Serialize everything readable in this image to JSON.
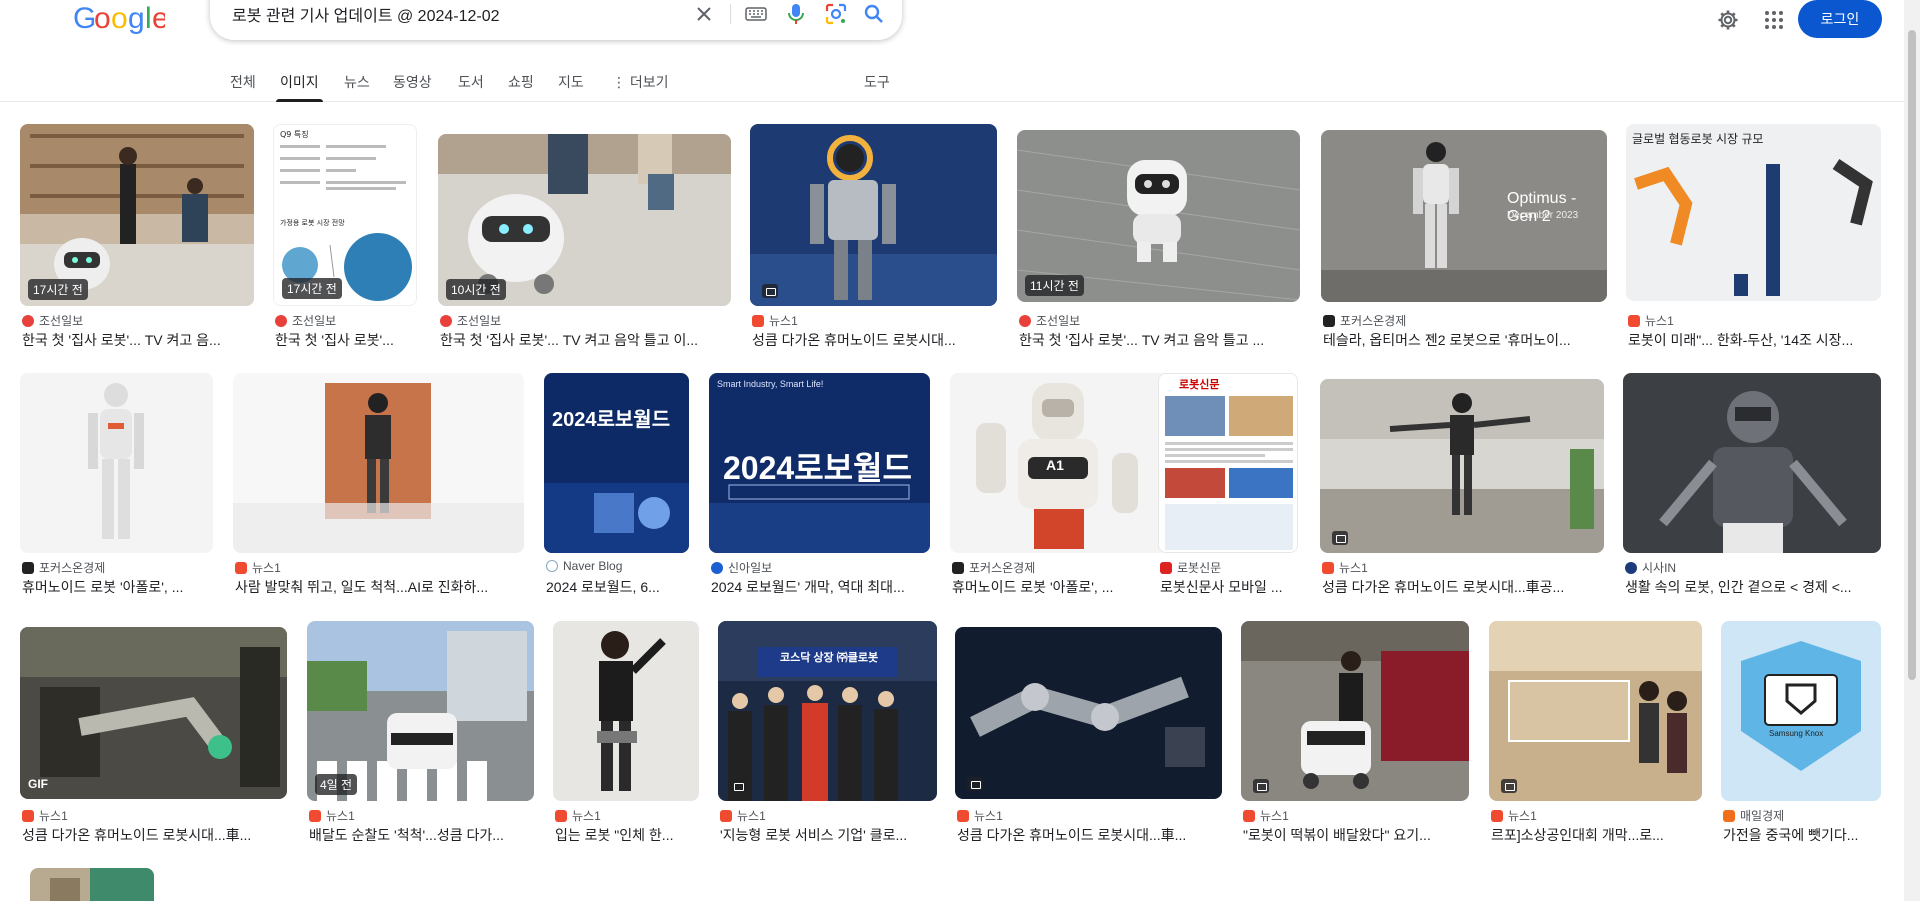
{
  "logo": {
    "text": "Google"
  },
  "search": {
    "query": "로봇 관련 기사 업데이트 @ 2024-12-02",
    "placeholder": ""
  },
  "header": {
    "login_label": "로그인"
  },
  "tabs": [
    {
      "label": "전체"
    },
    {
      "label": "이미지"
    },
    {
      "label": "뉴스"
    },
    {
      "label": "동영상"
    },
    {
      "label": "도서"
    },
    {
      "label": "쇼핑"
    },
    {
      "label": "지도"
    },
    {
      "label": "⋮ 더보기"
    },
    {
      "label": "도구"
    }
  ],
  "results": [
    {
      "source": "조선일보",
      "title": "한국 첫 '집사 로봇'... TV 켜고 음...",
      "badge": "17시간 전"
    },
    {
      "source": "조선일보",
      "title": "한국 첫 '집사 로봇'...",
      "badge": "17시간 전"
    },
    {
      "source": "조선일보",
      "title": "한국 첫 '집사 로봇'... TV 켜고 음악 틀고 이...",
      "badge": "10시간 전"
    },
    {
      "source": "뉴스1",
      "title": "성큼 다가온 휴머노이드 로봇시대...",
      "badge": ""
    },
    {
      "source": "조선일보",
      "title": "한국 첫 '집사 로봇'... TV 켜고 음악 틀고 ...",
      "badge": "11시간 전"
    },
    {
      "source": "포커스온경제",
      "title": "테슬라, 옵티머스 젠2 로봇으로 '휴머노이...",
      "badge": "",
      "overlay": "Optimus - Gen 2",
      "overlay2": "December 2023"
    },
    {
      "source": "뉴스1",
      "title": "로봇이 미래\"... 한화-두산, '14조 시장...",
      "badge": "",
      "overlay": "글로벌 협동로봇 시장 규모"
    },
    {
      "source": "포커스온경제",
      "title": "휴머노이드 로봇 '아폴로', ...",
      "badge": ""
    },
    {
      "source": "뉴스1",
      "title": "사람 발맞춰 뛰고, 일도 척척...AI로 진화하...",
      "badge": ""
    },
    {
      "source": "Naver Blog",
      "title": "2024 로보월드, 6...",
      "badge": "",
      "overlay": "2024로보월드"
    },
    {
      "source": "신아일보",
      "title": "2024 로보월드' 개막, 역대 최대...",
      "badge": "",
      "overlay": "2024로보월드",
      "overlay2": "Smart Industry, Smart Life!"
    },
    {
      "source": "포커스온경제",
      "title": "휴머노이드 로봇 '아폴로', ...",
      "badge": "",
      "overlay": "A1"
    },
    {
      "source": "로봇신문",
      "title": "로봇신문사 모바일 ...",
      "badge": "",
      "overlay": "로봇신문"
    },
    {
      "source": "뉴스1",
      "title": "성큼 다가온 휴머노이드 로봇시대...車공...",
      "badge": ""
    },
    {
      "source": "시사IN",
      "title": "생활 속의 로봇, 인간 곁으로 < 경제 <...",
      "badge": ""
    },
    {
      "source": "뉴스1",
      "title": "성큼 다가온 휴머노이드 로봇시대...車...",
      "badge": "GIF"
    },
    {
      "source": "뉴스1",
      "title": "배달도 순찰도 '척척'...성큼 다가...",
      "badge": "4일 전"
    },
    {
      "source": "뉴스1",
      "title": "입는 로봇 \"인체 한...",
      "badge": ""
    },
    {
      "source": "뉴스1",
      "title": "'지능형 로봇 서비스 기업' 클로...",
      "badge": "",
      "overlay": "코스닥 상장 ㈜클로봇"
    },
    {
      "source": "뉴스1",
      "title": "성큼 다가온 휴머노이드 로봇시대...車...",
      "badge": ""
    },
    {
      "source": "뉴스1",
      "title": "\"로봇이 떡볶이 배달왔다\" 요기...",
      "badge": ""
    },
    {
      "source": "뉴스1",
      "title": "르포]소상공인대회 개막...로...",
      "badge": ""
    },
    {
      "source": "매일경제",
      "title": "가전을 중국에 뺏기다...",
      "badge": "",
      "overlay": "Samsung Knox"
    }
  ],
  "colors": {
    "accent": "#0b57d0",
    "google_blue": "#4285f4",
    "google_red": "#ea4335",
    "google_yellow": "#fbbc05",
    "google_green": "#34a853"
  }
}
